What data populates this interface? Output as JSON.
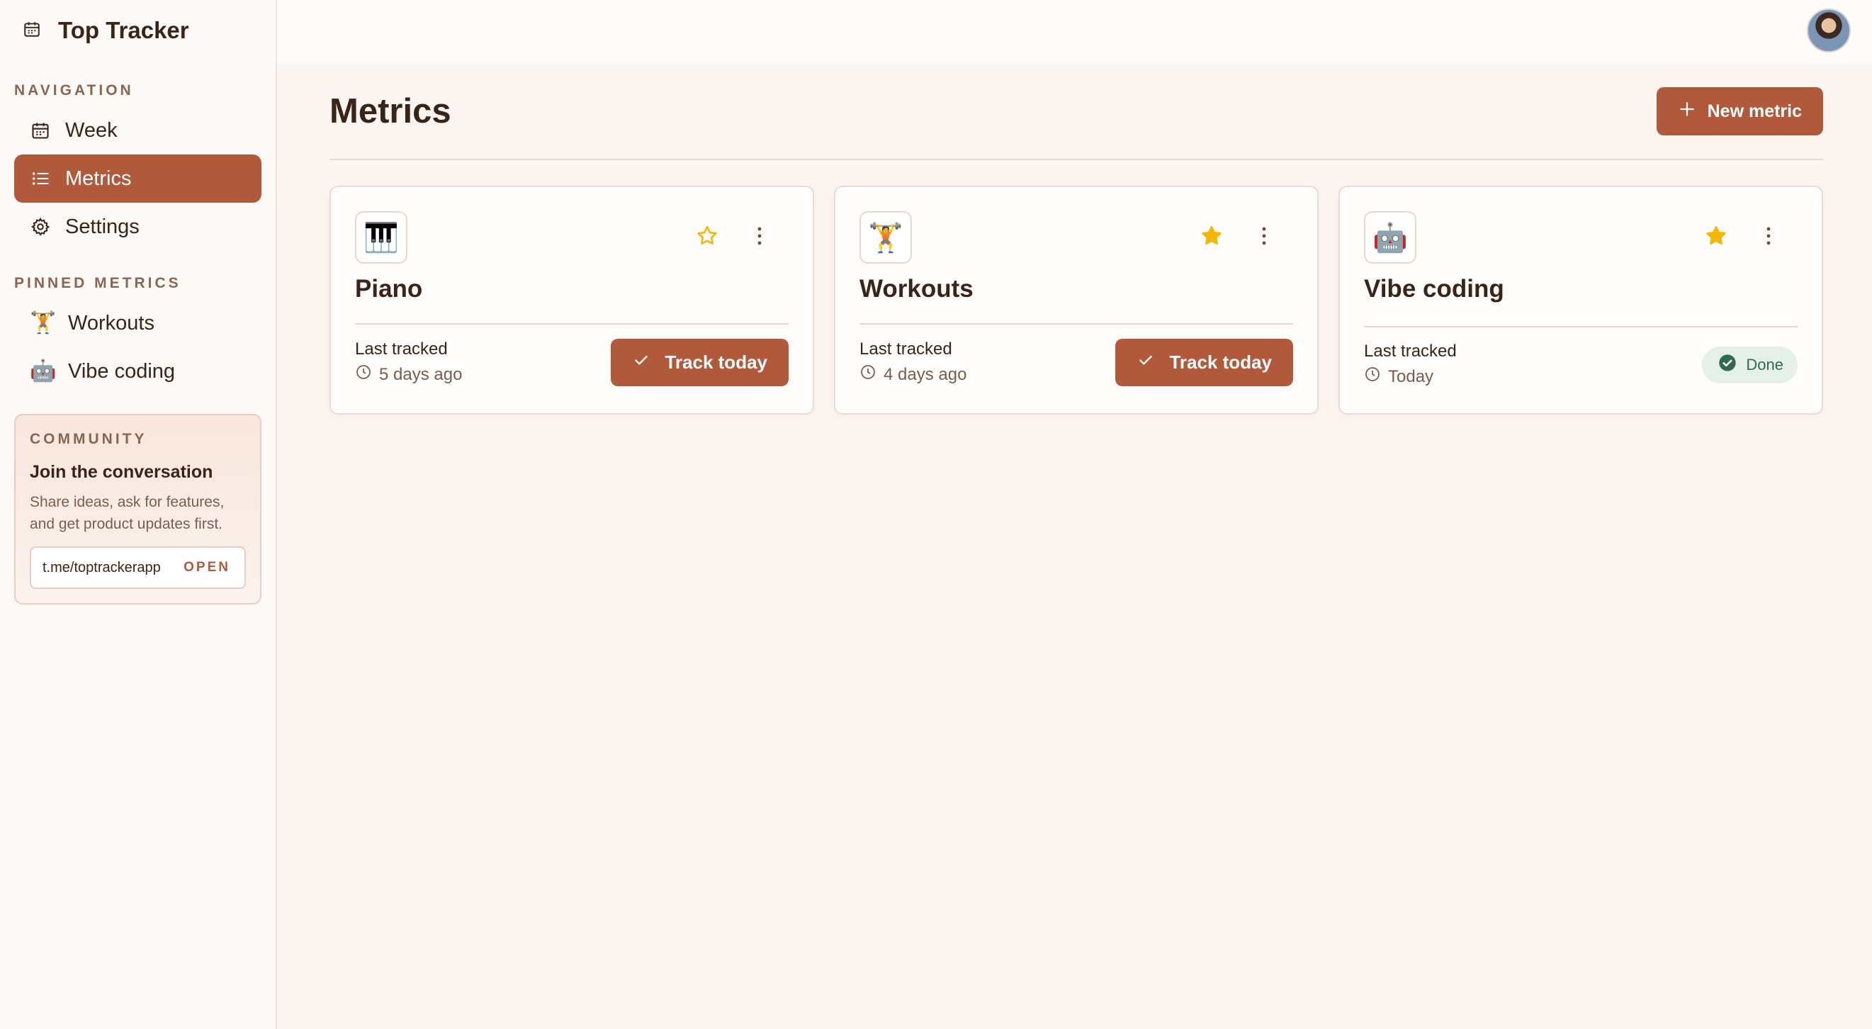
{
  "app": {
    "title": "Top Tracker",
    "icon": "calendar-icon"
  },
  "sidebar": {
    "nav_label": "NAVIGATION",
    "nav_items": [
      {
        "label": "Week",
        "icon": "calendar-icon"
      },
      {
        "label": "Metrics",
        "icon": "list-icon",
        "active": true
      },
      {
        "label": "Settings",
        "icon": "gear-icon"
      }
    ],
    "pinned_label": "PINNED METRICS",
    "pinned_items": [
      {
        "label": "Workouts",
        "emoji": "🏋️"
      },
      {
        "label": "Vibe coding",
        "emoji": "🤖"
      }
    ],
    "community": {
      "label": "COMMUNITY",
      "title": "Join the conversation",
      "description": "Share ideas, ask for features, and get product updates first.",
      "link": "t.me/toptrackerapp",
      "open_label": "OPEN"
    }
  },
  "header": {
    "title": "Metrics",
    "new_button": "New metric"
  },
  "cards": [
    {
      "emoji": "🎹",
      "title": "Piano",
      "starred": false,
      "last_label": "Last tracked",
      "last_value": "5 days ago",
      "action": "Track today"
    },
    {
      "emoji": "🏋️",
      "title": "Workouts",
      "starred": true,
      "last_label": "Last tracked",
      "last_value": "4 days ago",
      "action": "Track today"
    },
    {
      "emoji": "🤖",
      "title": "Vibe coding",
      "starred": true,
      "last_label": "Last tracked",
      "last_value": "Today",
      "status": "Done"
    }
  ],
  "colors": {
    "accent": "#b05a3b",
    "star": "#f2b705",
    "done_bg": "#e5f0ea",
    "done_fg": "#2f6b4f"
  }
}
